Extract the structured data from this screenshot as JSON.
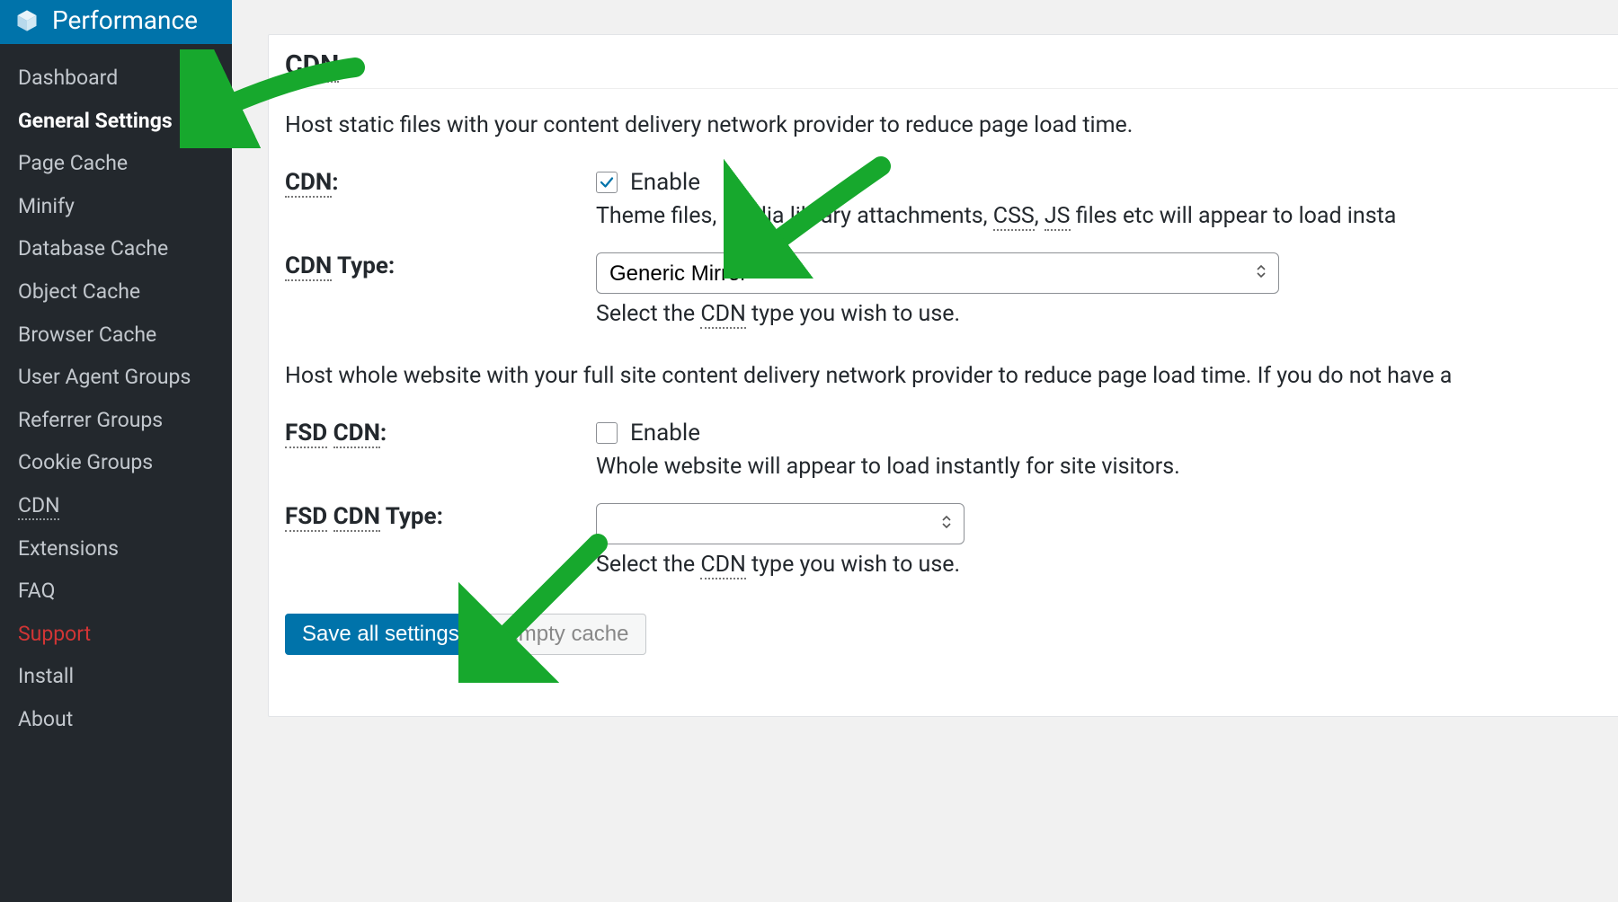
{
  "sidebar": {
    "header": "Performance",
    "items": [
      {
        "label": "Dashboard"
      },
      {
        "label": "General Settings",
        "current": true
      },
      {
        "label": "Page Cache"
      },
      {
        "label": "Minify"
      },
      {
        "label": "Database Cache"
      },
      {
        "label": "Object Cache"
      },
      {
        "label": "Browser Cache"
      },
      {
        "label": "User Agent Groups"
      },
      {
        "label": "Referrer Groups"
      },
      {
        "label": "Cookie Groups"
      },
      {
        "label": "CDN",
        "dotted": true
      },
      {
        "label": "Extensions"
      },
      {
        "label": "FAQ"
      },
      {
        "label": "Support",
        "support": true
      },
      {
        "label": "Install"
      },
      {
        "label": "About"
      }
    ]
  },
  "panel": {
    "section_title": "CDN",
    "intro": "Host static files with your content delivery network provider to reduce page load time.",
    "cdn": {
      "label_abbr": "CDN",
      "label_suffix": ":",
      "enable_label": "Enable",
      "checked": true,
      "help_prefix": "Theme files, media library attachments, ",
      "help_css": "CSS",
      "help_sep": ", ",
      "help_js": "JS",
      "help_suffix": " files etc will appear to load insta"
    },
    "cdn_type": {
      "label_abbr": "CDN",
      "label_rest": " Type:",
      "value": "Generic Mirror",
      "help_prefix": "Select the ",
      "help_abbr": "CDN",
      "help_suffix": " type you wish to use."
    },
    "fsd_intro": "Host whole website with your full site content delivery network provider to reduce page load time. If you do not have a",
    "fsd_cdn": {
      "label_fsd": "FSD",
      "label_cdn": "CDN",
      "label_suffix": ":",
      "enable_label": "Enable",
      "checked": false,
      "help": "Whole website will appear to load instantly for site visitors."
    },
    "fsd_cdn_type": {
      "label_fsd": "FSD",
      "label_cdn": "CDN",
      "label_rest": " Type:",
      "value": "",
      "help_prefix": "Select the ",
      "help_abbr": "CDN",
      "help_suffix": " type you wish to use."
    },
    "buttons": {
      "save": "Save all settings",
      "empty": "Empty cache"
    }
  }
}
